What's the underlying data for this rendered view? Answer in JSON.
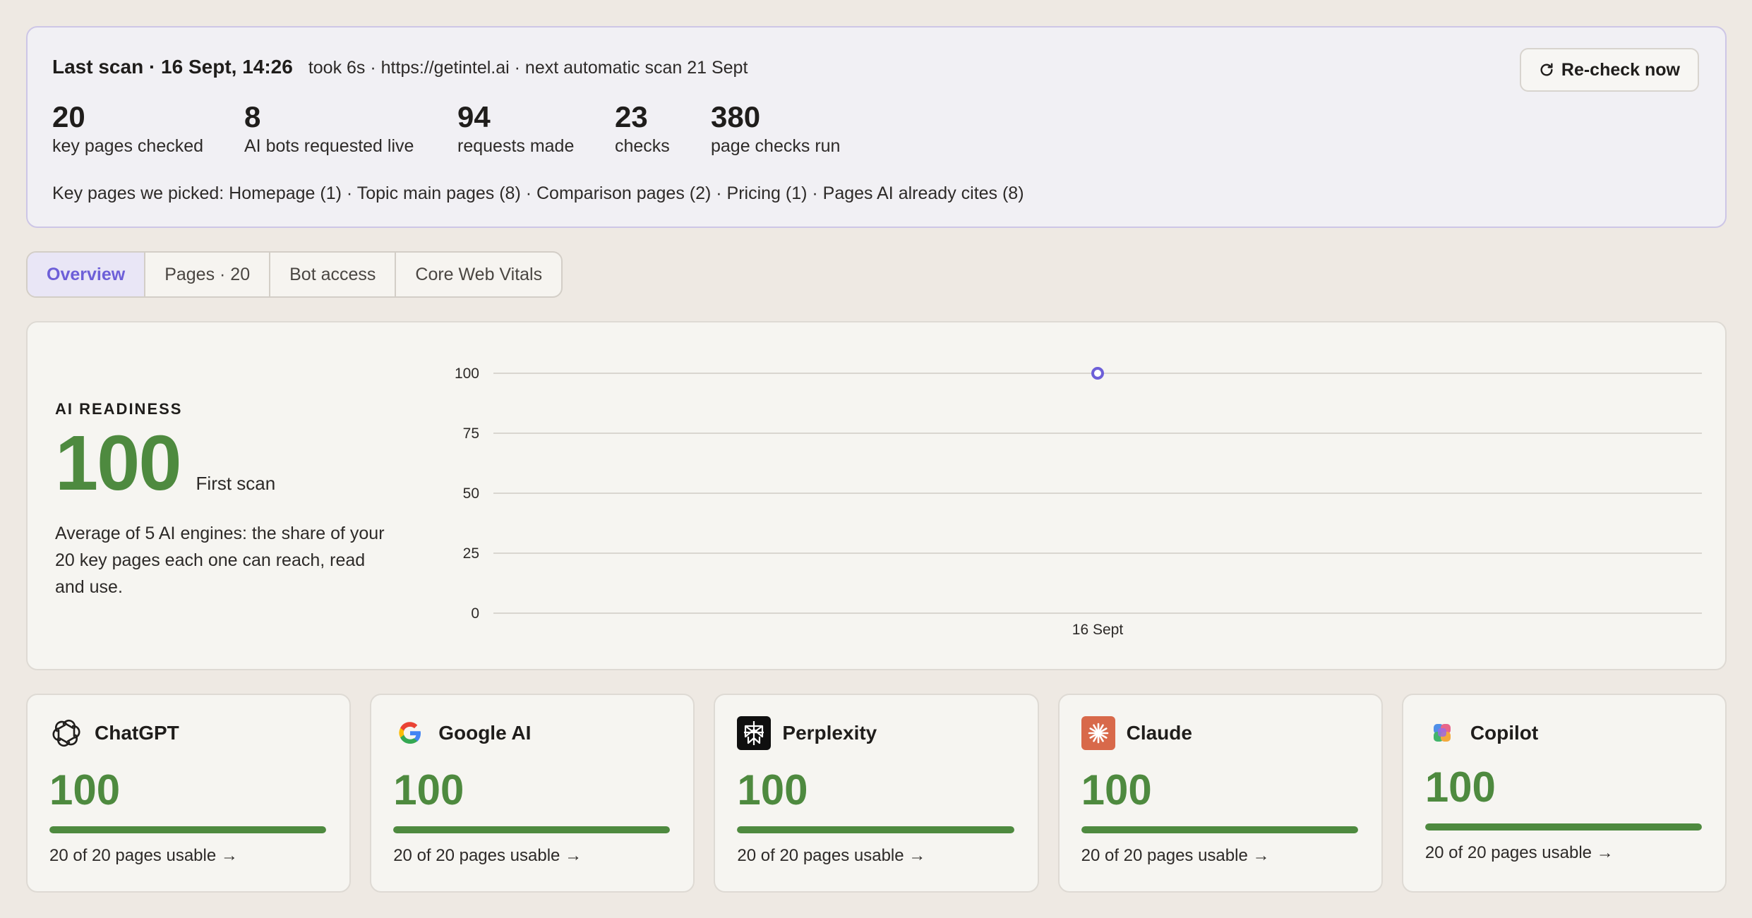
{
  "summary": {
    "last_scan": "Last scan · 16 Sept, 14:26",
    "meta": "took 6s · https://getintel.ai · next automatic scan 21 Sept",
    "recheck_label": "Re-check now",
    "stats": [
      {
        "value": "20",
        "label": "key pages checked"
      },
      {
        "value": "8",
        "label": "AI bots requested live"
      },
      {
        "value": "94",
        "label": "requests made"
      },
      {
        "value": "23",
        "label": "checks"
      },
      {
        "value": "380",
        "label": "page checks run"
      }
    ],
    "picked": "Key pages we picked: Homepage (1) · Topic main pages (8) · Comparison pages (2) · Pricing (1) · Pages AI already cites (8)"
  },
  "tabs": [
    {
      "label": "Overview",
      "active": true
    },
    {
      "label": "Pages · 20",
      "active": false
    },
    {
      "label": "Bot access",
      "active": false
    },
    {
      "label": "Core Web Vitals",
      "active": false
    }
  ],
  "readiness": {
    "title": "AI READINESS",
    "score": "100",
    "sub": "First scan",
    "description": "Average of 5 AI engines: the share of your 20 key pages each one can reach, read and use."
  },
  "chart_data": {
    "type": "line",
    "x": [
      "16 Sept"
    ],
    "series": [
      {
        "values": [
          100
        ]
      }
    ],
    "yticks": [
      100,
      75,
      50,
      25,
      0
    ],
    "ylim": [
      0,
      100
    ],
    "grid": true,
    "color": "#6d5fd8"
  },
  "engines": [
    {
      "name": "ChatGPT",
      "icon": "chatgpt-logo-icon",
      "score": "100",
      "fill": 1.0,
      "footer": "20 of 20 pages usable →"
    },
    {
      "name": "Google AI",
      "icon": "google-logo-icon",
      "score": "100",
      "fill": 1.0,
      "footer": "20 of 20 pages usable →"
    },
    {
      "name": "Perplexity",
      "icon": "perplexity-logo-icon",
      "score": "100",
      "fill": 1.0,
      "footer": "20 of 20 pages usable →"
    },
    {
      "name": "Claude",
      "icon": "claude-logo-icon",
      "score": "100",
      "fill": 1.0,
      "footer": "20 of 20 pages usable →"
    },
    {
      "name": "Copilot",
      "icon": "copilot-logo-icon",
      "score": "100",
      "fill": 1.0,
      "footer": "20 of 20 pages usable →"
    }
  ],
  "colors": {
    "accent": "#6d5fd8",
    "good": "#4e8a3f"
  }
}
